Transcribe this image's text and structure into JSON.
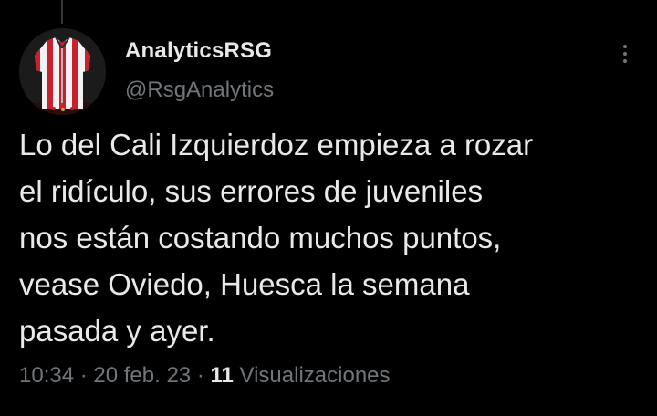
{
  "author": {
    "display_name": "AnalyticsRSG",
    "handle": "@RsgAnalytics",
    "avatar_icon": "striped-jersey-avatar"
  },
  "tweet": {
    "text": "Lo del Cali Izquierdoz empieza a rozar\nel ridículo, sus errores de juveniles\nnos están costando muchos puntos,\nvease Oviedo, Huesca la semana\npasada y ayer."
  },
  "meta": {
    "time": "10:34",
    "separator": " · ",
    "date": "20 feb. 23",
    "views_count": "11",
    "views_label": " Visualizaciones"
  },
  "actions": {
    "more_icon": "vertical-ellipsis-icon"
  },
  "colors": {
    "background": "#000000",
    "primary_text": "#e7e9ea",
    "secondary_text": "#71767b",
    "jersey_red": "#c8202f",
    "jersey_white": "#f2f2f2"
  }
}
